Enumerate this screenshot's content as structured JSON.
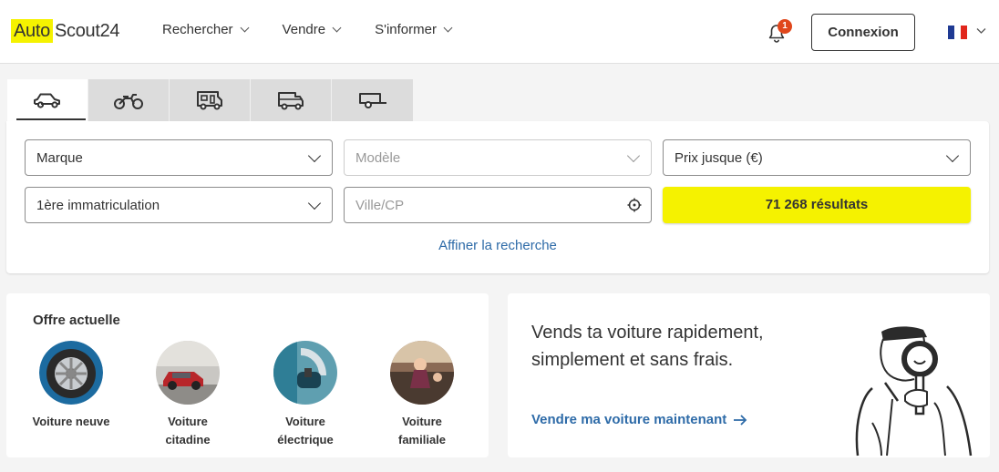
{
  "header": {
    "logo_part1": "Auto",
    "logo_part2": "Scout24",
    "nav": [
      "Rechercher",
      "Vendre",
      "S'informer"
    ],
    "notification_count": "1",
    "login_label": "Connexion",
    "language_flag": "france-flag-icon",
    "brand_colors": {
      "yellow": "#f5f200",
      "link_blue": "#2e6ba8",
      "badge_red": "#e0471c"
    }
  },
  "tabs": [
    {
      "icon": "car-icon",
      "active": true
    },
    {
      "icon": "motorcycle-icon",
      "active": false
    },
    {
      "icon": "camper-icon",
      "active": false
    },
    {
      "icon": "van-icon",
      "active": false
    },
    {
      "icon": "trailer-icon",
      "active": false
    }
  ],
  "search": {
    "brand": "Marque",
    "model": "Modèle",
    "price": "Prix jusque (€)",
    "registration": "1ère immatriculation",
    "location_placeholder": "Ville/CP",
    "results_label": "71 268 résultats",
    "refine_label": "Affiner la recherche"
  },
  "offers": {
    "title": "Offre actuelle",
    "items": [
      {
        "line1": "Voiture neuve",
        "line2": ""
      },
      {
        "line1": "Voiture",
        "line2": "citadine"
      },
      {
        "line1": "Voiture",
        "line2": "électrique"
      },
      {
        "line1": "Voiture",
        "line2": "familiale"
      }
    ]
  },
  "sell": {
    "title": "Vends ta voiture rapidement, simplement et sans frais.",
    "link": "Vendre ma voiture maintenant"
  }
}
